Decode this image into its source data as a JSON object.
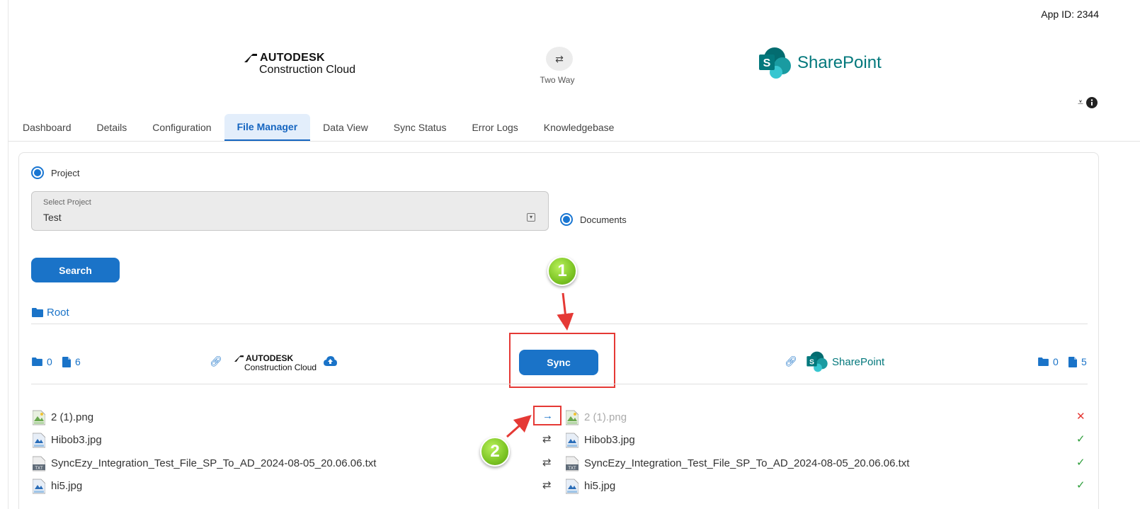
{
  "app_id": "App ID: 2344",
  "brand": {
    "left_top": "AUTODESK",
    "left_bottom": "Construction Cloud",
    "mode_icon": "swap-arrows-icon",
    "mode_label": "Two Way",
    "right_name": "SharePoint",
    "colors": {
      "sharepoint": "#03787c",
      "accent": "#1a73c8"
    }
  },
  "tabs": [
    {
      "label": "Dashboard"
    },
    {
      "label": "Details"
    },
    {
      "label": "Configuration"
    },
    {
      "label": "File Manager",
      "active": true
    },
    {
      "label": "Data View"
    },
    {
      "label": "Sync Status"
    },
    {
      "label": "Error Logs"
    },
    {
      "label": "Knowledgebase"
    }
  ],
  "filters": {
    "project_radio": "Project",
    "select_label": "Select Project",
    "select_value": "Test",
    "documents_radio": "Documents",
    "search_label": "Search"
  },
  "breadcrumb": {
    "root": "Root"
  },
  "toolbar": {
    "left_folders": "0",
    "left_files": "6",
    "sync_label": "Sync",
    "right_folders": "0",
    "right_files": "5"
  },
  "files": [
    {
      "left": "2 (1).png",
      "direction": "→",
      "right": "2 (1).png",
      "status": "✕"
    },
    {
      "left": "Hibob3.jpg",
      "direction": "⇄",
      "right": "Hibob3.jpg",
      "status": "✓"
    },
    {
      "left": "SyncEzy_Integration_Test_File_SP_To_AD_2024-08-05_20.06.06.txt",
      "direction": "⇄",
      "right": "SyncEzy_Integration_Test_File_SP_To_AD_2024-08-05_20.06.06.txt",
      "status": "✓"
    },
    {
      "left": "hi5.jpg",
      "direction": "⇄",
      "right": "hi5.jpg",
      "status": "✓"
    }
  ],
  "callouts": {
    "one": "1",
    "two": "2"
  }
}
